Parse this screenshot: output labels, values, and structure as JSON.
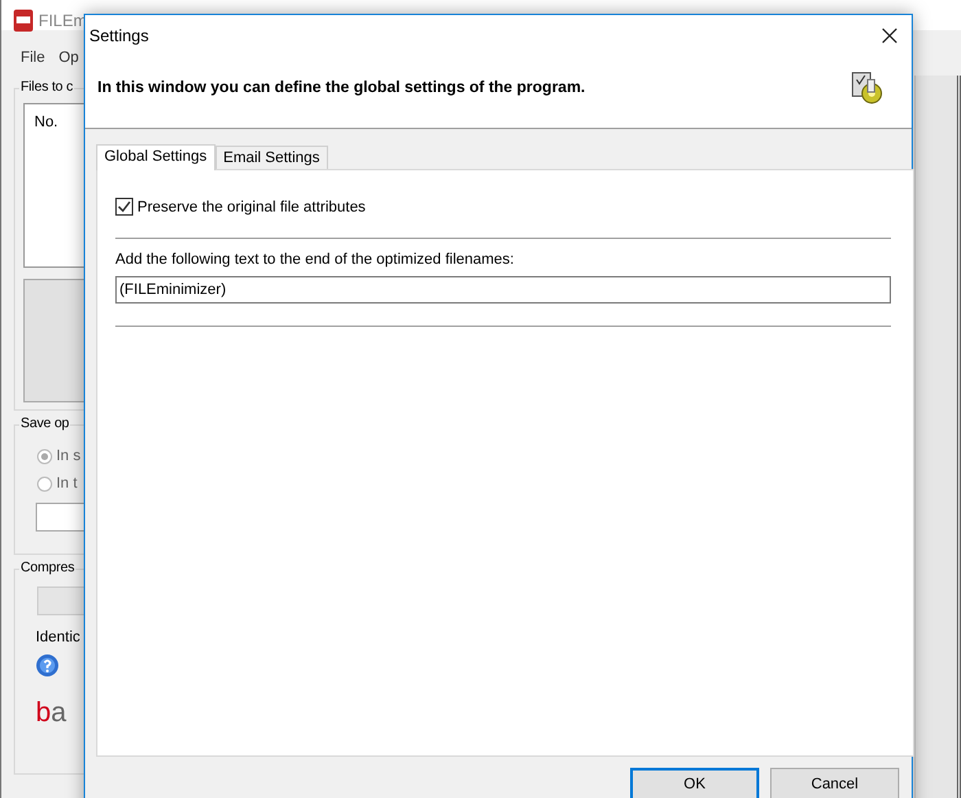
{
  "main_window": {
    "title": "FILEm",
    "menu": [
      "File",
      "Op"
    ],
    "files_group": {
      "label": "Files to c",
      "column_1": "No."
    },
    "save_group": {
      "label": "Save op",
      "options": [
        {
          "label": "In s",
          "selected": true
        },
        {
          "label": "In t",
          "selected": false
        }
      ]
    },
    "compress_group": {
      "label": "Compres",
      "slider_label": "Identic"
    },
    "logo": "ba"
  },
  "dialog": {
    "title": "Settings",
    "header_text": "In this window you can define the global settings of the program.",
    "tabs": [
      {
        "label": "Global Settings",
        "selected": true
      },
      {
        "label": "Email Settings",
        "selected": false
      }
    ],
    "preserve_attributes": {
      "label": "Preserve the original file attributes",
      "checked": true
    },
    "suffix": {
      "label": "Add the following text to the end of the optimized filenames:",
      "value": "(FILEminimizer)"
    },
    "buttons": [
      "OK",
      "Cancel"
    ]
  }
}
